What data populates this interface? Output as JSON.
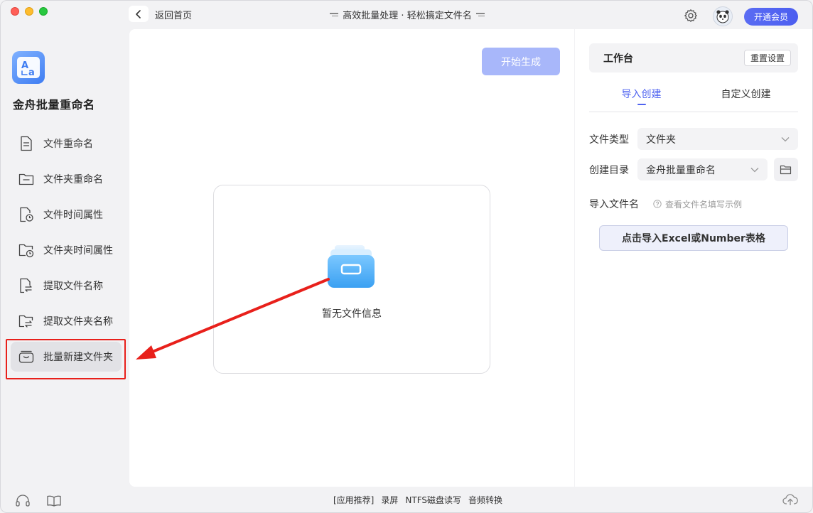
{
  "titlebar": {
    "back_label": "返回首页",
    "title": "高效批量处理 · 轻松搞定文件名",
    "vip_label": "开通会员"
  },
  "sidebar": {
    "app_name": "金舟批量重命名",
    "items": [
      {
        "label": "文件重命名",
        "icon": "file-doc-icon"
      },
      {
        "label": "文件夹重命名",
        "icon": "folder-icon"
      },
      {
        "label": "文件时间属性",
        "icon": "file-clock-icon"
      },
      {
        "label": "文件夹时间属性",
        "icon": "folder-clock-icon"
      },
      {
        "label": "提取文件名称",
        "icon": "file-extract-icon"
      },
      {
        "label": "提取文件夹名称",
        "icon": "folder-extract-icon"
      },
      {
        "label": "批量新建文件夹",
        "icon": "archive-box-icon"
      }
    ],
    "active_index": 6
  },
  "main": {
    "start_label": "开始生成",
    "empty_text": "暂无文件信息"
  },
  "workbench": {
    "title": "工作台",
    "reset_label": "重置设置",
    "tabs": [
      "导入创建",
      "自定义创建"
    ],
    "active_tab": 0,
    "file_type_label": "文件类型",
    "file_type_value": "文件夹",
    "dir_label": "创建目录",
    "dir_value": "金舟批量重命名",
    "import_label": "导入文件名",
    "import_hint": "查看文件名填写示例",
    "import_button": "点击导入Excel或Number表格"
  },
  "footer": {
    "links": [
      "[应用推荐]",
      "录屏",
      "NTFS磁盘读写",
      "音频转换"
    ]
  },
  "colors": {
    "accent": "#4f63f0",
    "start_button": "#a8b7fa",
    "highlight": "#e8201b"
  }
}
